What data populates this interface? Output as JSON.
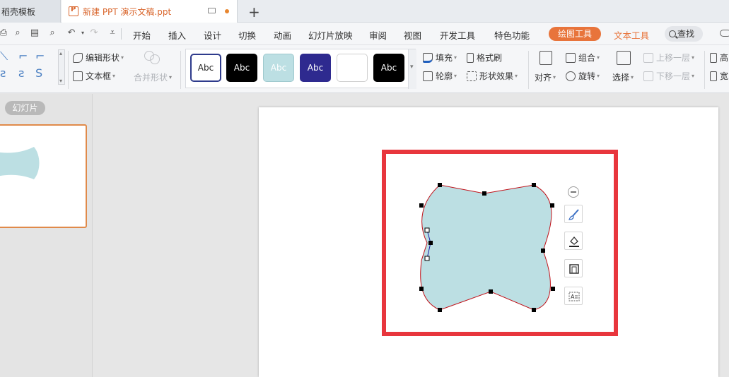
{
  "tabs": {
    "template_label": "稻壳模板",
    "doc_label": "新建 PPT 演示文稿.ppt",
    "add_label": "+"
  },
  "menu": {
    "items": [
      "开始",
      "插入",
      "设计",
      "切换",
      "动画",
      "幻灯片放映",
      "审阅",
      "视图",
      "开发工具",
      "特色功能"
    ],
    "draw_tools": "绘图工具",
    "text_tools": "文本工具",
    "search": "查找"
  },
  "ribbon": {
    "edit_shape": "编辑形状",
    "text_box": "文本框",
    "merge_shape": "合并形状",
    "styles": [
      {
        "label": "Abc",
        "bg": "#ffffff",
        "fg": "#222222",
        "border": "#2e3b8c"
      },
      {
        "label": "Abc",
        "bg": "#000000",
        "fg": "#ffffff",
        "border": "#000000"
      },
      {
        "label": "Abc",
        "bg": "#bcdfe3",
        "fg": "#ffffff",
        "border": "#9fc9ce"
      },
      {
        "label": "Abc",
        "bg": "#2e2a8f",
        "fg": "#ffffff",
        "border": "#2e2a8f"
      },
      {
        "label": "",
        "bg": "#ffffff",
        "fg": "#222222",
        "border": "#cfcfcf"
      },
      {
        "label": "Abc",
        "bg": "#000000",
        "fg": "#ffffff",
        "border": "#000000"
      }
    ],
    "fill": "填充",
    "format_painter": "格式刷",
    "outline": "轮廓",
    "shape_effects": "形状效果",
    "align": "对齐",
    "group": "组合",
    "rotate": "旋转",
    "select": "选择",
    "bring_forward": "上移一层",
    "send_backward": "下移一层",
    "height_trunc": "高",
    "width_trunc": "宽"
  },
  "left_panel": {
    "slides_label": "幻灯片"
  },
  "colors": {
    "accent": "#e8743b",
    "shape_fill": "#bcdfe3",
    "shape_outline": "#c0121a",
    "highlight_box": "#e8363d",
    "thumb_border": "#e08a4a"
  }
}
